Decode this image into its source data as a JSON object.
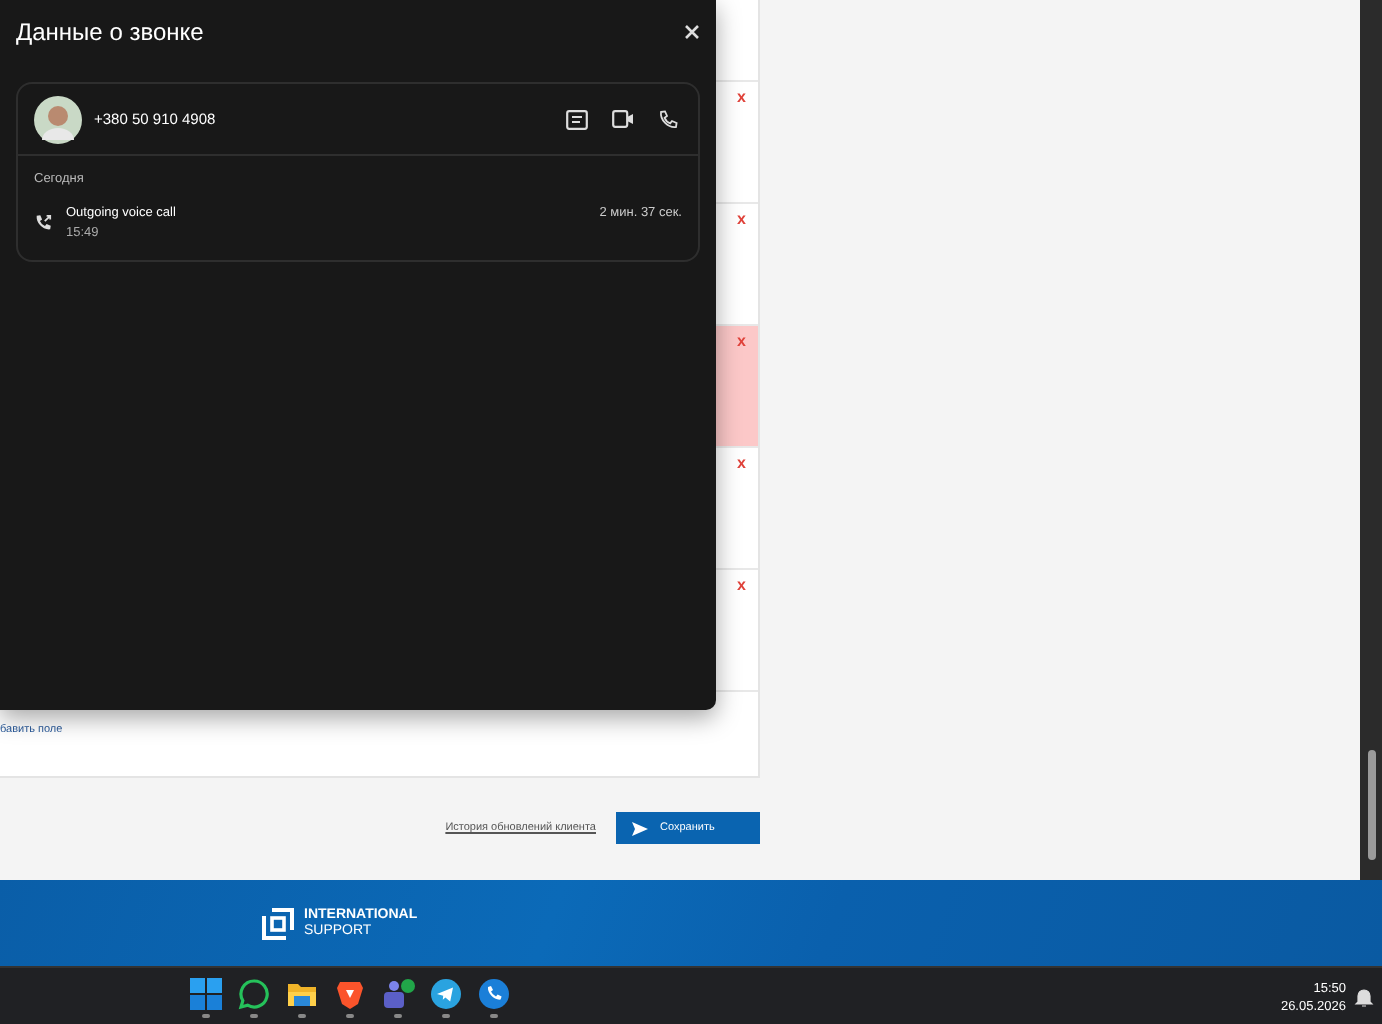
{
  "dialog": {
    "title": "Данные о звонке",
    "contact": {
      "phone": "+380 50 910 4908"
    },
    "section": "Сегодня",
    "calls": [
      {
        "title": "Outgoing voice call",
        "time": "15:49",
        "duration": "2 мин. 37 сек."
      }
    ]
  },
  "form": {
    "rows": [
      {
        "remove_mark": "x",
        "highlighted": false
      },
      {
        "remove_mark": "x",
        "highlighted": false
      },
      {
        "remove_mark": "x",
        "highlighted": true
      },
      {
        "remove_mark": "x",
        "highlighted": false
      },
      {
        "remove_mark": "x",
        "highlighted": false
      }
    ],
    "add_field_link": "бавить поле",
    "history_link": "История обновлений клиента",
    "save_button": "Сохранить"
  },
  "footer": {
    "logo_line_1": "INTERNATIONAL",
    "logo_line_2": "SUPPORT"
  },
  "taskbar": {
    "apps": [
      {
        "kind": "start"
      },
      {
        "kind": "chat"
      },
      {
        "kind": "folder"
      },
      {
        "kind": "shield"
      },
      {
        "kind": "teams"
      },
      {
        "kind": "plane"
      },
      {
        "kind": "phone"
      }
    ],
    "time": "15:50",
    "date": "26.05.2026"
  }
}
